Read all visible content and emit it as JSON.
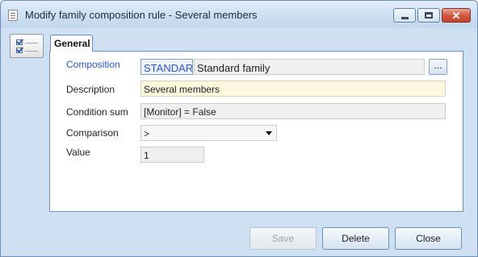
{
  "window": {
    "title": "Modify family composition rule - Several members",
    "controls": {
      "minimize": "minimize-icon",
      "maximize": "maximize-icon",
      "close": "close-icon"
    }
  },
  "tabs": [
    {
      "label": "General"
    }
  ],
  "form": {
    "composition": {
      "label": "Composition",
      "code": "STANDARI",
      "name": "Standard family",
      "lookup_label": "..."
    },
    "description": {
      "label": "Description",
      "value": "Several members"
    },
    "condition_sum": {
      "label": "Condition sum",
      "value": "[Monitor] = False"
    },
    "comparison": {
      "label": "Comparison",
      "value": ">"
    },
    "value": {
      "label": "Value",
      "value": "1"
    }
  },
  "buttons": {
    "save": "Save",
    "delete": "Delete",
    "close": "Close"
  },
  "colors": {
    "accent": "#2b58c4",
    "description_bg": "#fdf7dd",
    "close_button": "#c7412b"
  }
}
